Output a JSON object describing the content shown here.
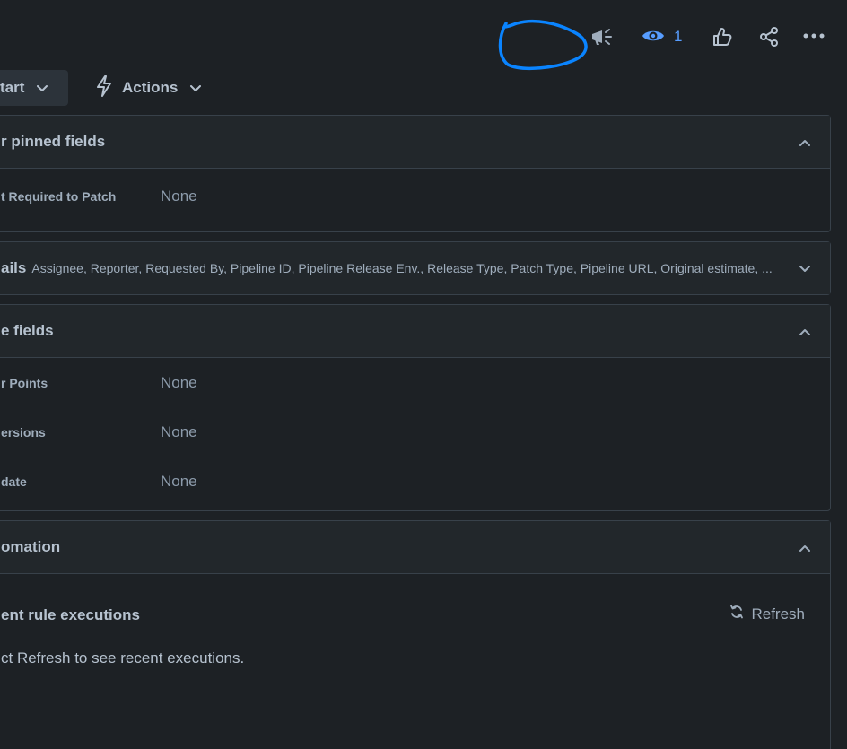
{
  "toolbar": {
    "watch_count": "1",
    "colors": {
      "watch_accent": "#579dff",
      "annotation": "#0a84ff"
    },
    "icons": [
      "annotation-scribble",
      "megaphone-icon",
      "eye-icon",
      "thumbs-up-icon",
      "share-icon",
      "more-icon"
    ]
  },
  "actions_row": {
    "start_label": "tart",
    "actions_label": "Actions"
  },
  "pinned": {
    "title": "r pinned fields",
    "fields": [
      {
        "label": "t Required to Patch",
        "value": "None"
      }
    ]
  },
  "details": {
    "title": "ails",
    "summary": "Assignee, Reporter, Requested By, Pipeline ID, Pipeline Release Env., Release Type, Patch Type, Pipeline URL, Original estimate, ..."
  },
  "more_fields": {
    "title": "e fields",
    "fields": [
      {
        "label": "r Points",
        "value": "None"
      },
      {
        "label": "ersions",
        "value": "None"
      },
      {
        "label": "date",
        "value": "None"
      }
    ]
  },
  "automation": {
    "title": "omation",
    "subtitle": "ent rule executions",
    "refresh_label": "Refresh",
    "hint": "ct Refresh to see recent executions."
  }
}
